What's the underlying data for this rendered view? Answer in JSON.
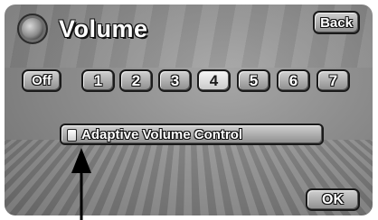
{
  "header": {
    "title": "Volume",
    "icon": "speaker-icon"
  },
  "back_button": {
    "label": "Back"
  },
  "volume_levels": {
    "selected": "4",
    "buttons": [
      "Off",
      "1",
      "2",
      "3",
      "4",
      "5",
      "6",
      "7"
    ]
  },
  "avc_button": {
    "label": "Adaptive Volume Control",
    "enabled": false
  },
  "ok_button": {
    "label": "OK"
  },
  "annotation": {
    "icon": "pointer-arrow-icon"
  }
}
